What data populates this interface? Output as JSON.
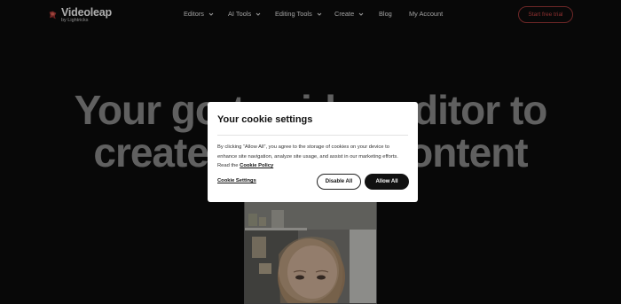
{
  "brand": {
    "name": "Videoleap",
    "sub": "by Lightricks",
    "accent": "#c93c3c"
  },
  "nav": {
    "items": [
      {
        "label": "Editors",
        "dropdown": true
      },
      {
        "label": "AI Tools",
        "dropdown": true
      },
      {
        "label": "Editing Tools",
        "dropdown": true
      },
      {
        "label": "Create",
        "dropdown": true
      },
      {
        "label": "Blog",
        "dropdown": false
      },
      {
        "label": "My Account",
        "dropdown": false
      }
    ],
    "cta": "Start free trial"
  },
  "hero": {
    "line1": "Your go-to video editor to",
    "line2": "create amazing content"
  },
  "cookie": {
    "title": "Your cookie settings",
    "body": "By clicking “Allow All”, you agree to the storage of cookies on your device to enhance site navigation, analyze site usage, and assist in our marketing efforts. Read the",
    "policy_link": "Cookie Policy",
    "settings_link": "Cookie Settings",
    "disable_label": "Disable All",
    "allow_label": "Allow All"
  }
}
